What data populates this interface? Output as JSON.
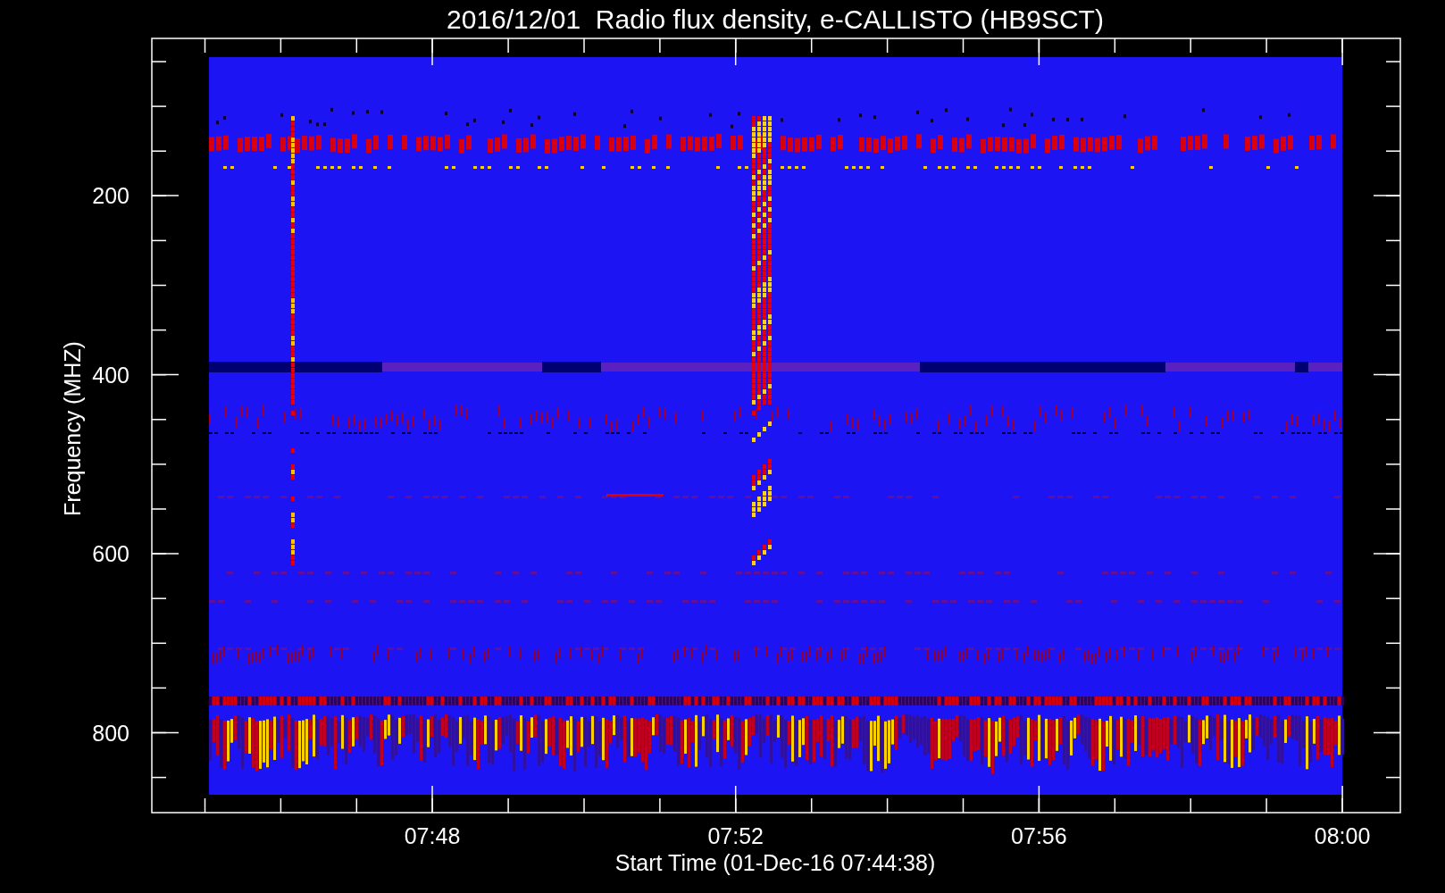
{
  "title": "2016/12/01  Radio flux density, e-CALLISTO (HB9SCT)",
  "y_axis": {
    "label": "Frequency (MHZ)",
    "ticks": [
      "200",
      "400",
      "600",
      "800"
    ]
  },
  "x_axis": {
    "label": "Start Time (01-Dec-16 07:44:38)",
    "ticks": [
      "07:48",
      "07:52",
      "07:56",
      "08:00"
    ]
  }
}
